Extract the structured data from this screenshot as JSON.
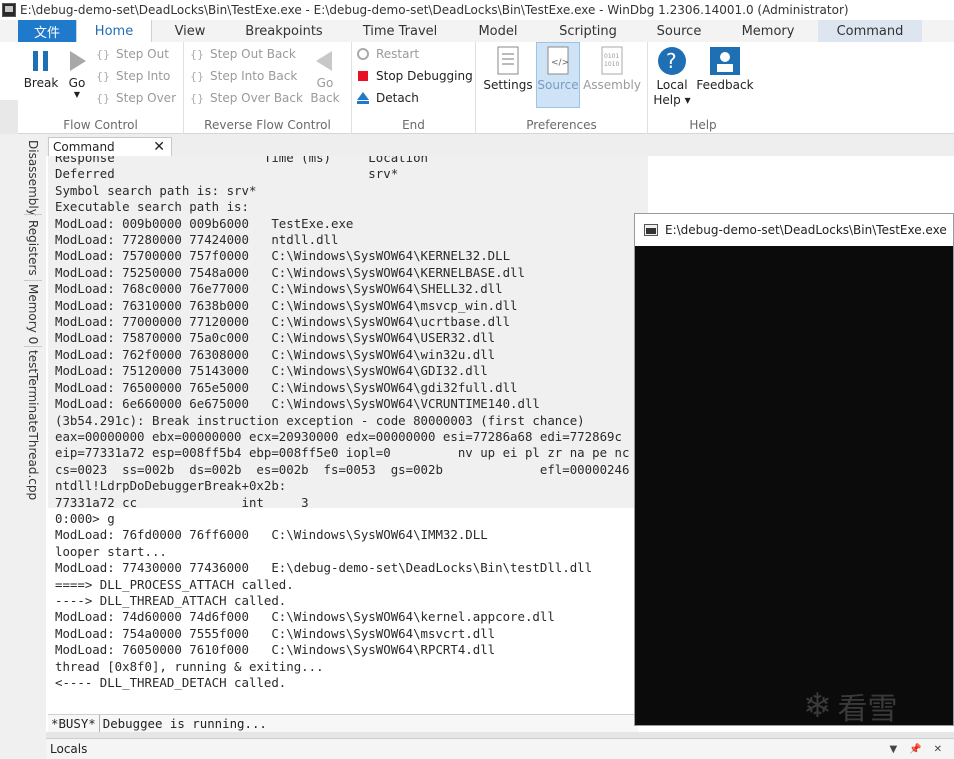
{
  "window": {
    "title": "E:\\debug-demo-set\\DeadLocks\\Bin\\TestExe.exe - E:\\debug-demo-set\\DeadLocks\\Bin\\TestExe.exe - WinDbg 1.2306.14001.0 (Administrator)"
  },
  "tabs": [
    {
      "label": "文件"
    },
    {
      "label": "Home"
    },
    {
      "label": "View"
    },
    {
      "label": "Breakpoints"
    },
    {
      "label": "Time Travel"
    },
    {
      "label": "Model"
    },
    {
      "label": "Scripting"
    },
    {
      "label": "Source"
    },
    {
      "label": "Memory"
    },
    {
      "label": "Command"
    }
  ],
  "ribbon": {
    "flow": {
      "label": "Flow Control",
      "break": "Break",
      "go": "Go",
      "step_out": "Step Out",
      "step_into": "Step Into",
      "step_over": "Step Over"
    },
    "reverse": {
      "label": "Reverse Flow Control",
      "step_out_back": "Step Out Back",
      "step_into_back": "Step Into Back",
      "step_over_back": "Step Over Back",
      "go_back_1": "Go",
      "go_back_2": "Back"
    },
    "end": {
      "label": "End",
      "restart": "Restart",
      "stop": "Stop Debugging",
      "detach": "Detach"
    },
    "prefs": {
      "label": "Preferences",
      "settings": "Settings",
      "source": "Source",
      "assembly": "Assembly"
    },
    "help": {
      "label": "Help",
      "local_help_1": "Local",
      "local_help_2": "Help ▾",
      "feedback": "Feedback"
    }
  },
  "side_tabs": [
    "Disassembly",
    "Registers",
    "Memory 0",
    "testTerminateThread.cpp"
  ],
  "command_tab": {
    "label": "Command",
    "close": "✕"
  },
  "output_lines_top": [
    "Response                    Time (ms)     Location",
    "Deferred                                  srv*",
    "Symbol search path is: srv*",
    "Executable search path is:",
    "ModLoad: 009b0000 009b6000   TestExe.exe",
    "ModLoad: 77280000 77424000   ntdll.dll",
    "ModLoad: 75700000 757f0000   C:\\Windows\\SysWOW64\\KERNEL32.DLL",
    "ModLoad: 75250000 7548a000   C:\\Windows\\SysWOW64\\KERNELBASE.dll",
    "ModLoad: 768c0000 76e77000   C:\\Windows\\SysWOW64\\SHELL32.dll",
    "ModLoad: 76310000 7638b000   C:\\Windows\\SysWOW64\\msvcp_win.dll",
    "ModLoad: 77000000 77120000   C:\\Windows\\SysWOW64\\ucrtbase.dll",
    "ModLoad: 75870000 75a0c000   C:\\Windows\\SysWOW64\\USER32.dll",
    "ModLoad: 762f0000 76308000   C:\\Windows\\SysWOW64\\win32u.dll",
    "ModLoad: 75120000 75143000   C:\\Windows\\SysWOW64\\GDI32.dll",
    "ModLoad: 76500000 765e5000   C:\\Windows\\SysWOW64\\gdi32full.dll",
    "ModLoad: 6e660000 6e675000   C:\\Windows\\SysWOW64\\VCRUNTIME140.dll",
    "(3b54.291c): Break instruction exception - code 80000003 (first chance)",
    "eax=00000000 ebx=00000000 ecx=20930000 edx=00000000 esi=77286a68 edi=772869c",
    "eip=77331a72 esp=008ff5b4 ebp=008ff5e0 iopl=0         nv up ei pl zr na pe nc",
    "cs=0023  ss=002b  ds=002b  es=002b  fs=0053  gs=002b             efl=00000246",
    "ntdll!LdrpDoDebuggerBreak+0x2b:",
    "77331a72 cc              int     3"
  ],
  "output_lines_bottom": [
    "0:000> g",
    "ModLoad: 76fd0000 76ff6000   C:\\Windows\\SysWOW64\\IMM32.DLL",
    "looper start...",
    "ModLoad: 77430000 77436000   E:\\debug-demo-set\\DeadLocks\\Bin\\testDll.dll",
    "====> DLL_PROCESS_ATTACH called.",
    "----> DLL_THREAD_ATTACH called.",
    "ModLoad: 74d60000 74d6f000   C:\\Windows\\SysWOW64\\kernel.appcore.dll",
    "ModLoad: 754a0000 7555f000   C:\\Windows\\SysWOW64\\msvcrt.dll",
    "ModLoad: 76050000 7610f000   C:\\Windows\\SysWOW64\\RPCRT4.dll",
    "thread [0x8f0], running & exiting...",
    "<---- DLL_THREAD_DETACH called."
  ],
  "status": {
    "busy": "*BUSY*",
    "message": "Debuggee is running..."
  },
  "locals": {
    "title": "Locals",
    "dropdown": "▼",
    "pin": "📌",
    "close": "✕"
  },
  "console": {
    "title": "E:\\debug-demo-set\\DeadLocks\\Bin\\TestExe.exe",
    "watermark": "看雪"
  },
  "colors": {
    "accent": "#1f7acb",
    "stop_red": "#e81123",
    "console_bg": "#0b0b0b"
  }
}
